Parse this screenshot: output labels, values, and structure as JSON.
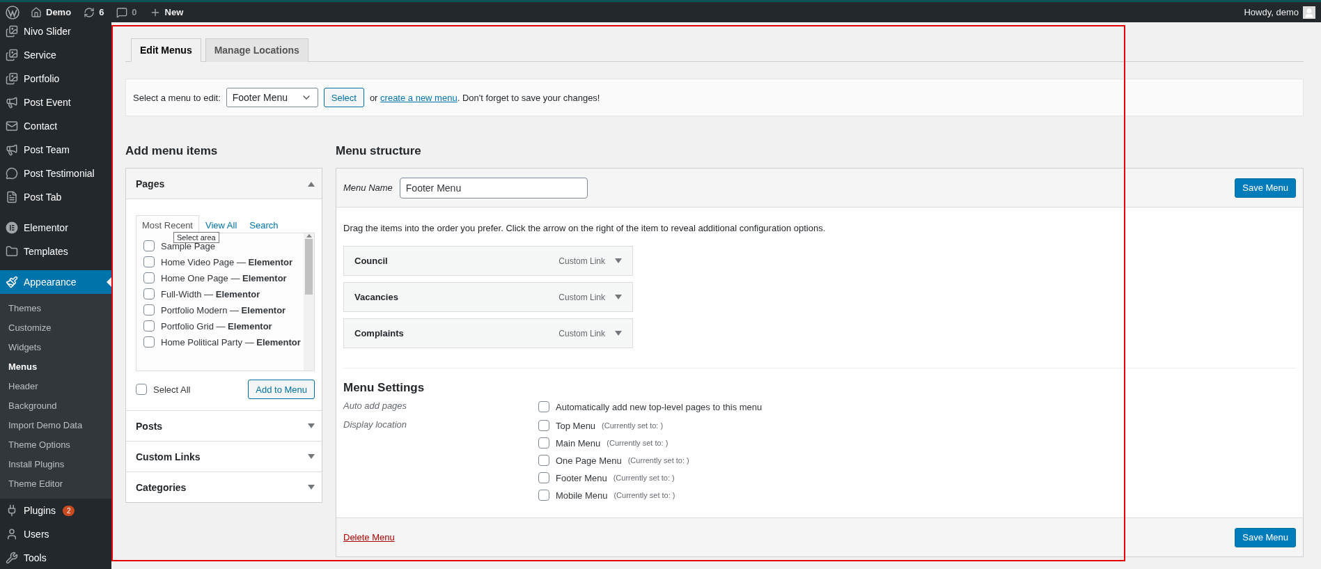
{
  "admin_bar": {
    "items": [
      {
        "label": "Demo"
      },
      {
        "label": "6"
      },
      {
        "label": "0"
      },
      {
        "label": "New"
      }
    ],
    "greeting": "Howdy, demo"
  },
  "sidebar": {
    "sections": [
      {
        "items": [
          {
            "label": "Nivo Slider",
            "selected": false
          },
          {
            "label": "Service",
            "selected": false
          },
          {
            "label": "Portfolio",
            "selected": false
          },
          {
            "label": "Post Event",
            "selected": false
          },
          {
            "label": "Contact",
            "selected": false
          },
          {
            "label": "Post Team",
            "selected": false
          },
          {
            "label": "Post Testimonial",
            "selected": false
          },
          {
            "label": "Post Tab",
            "selected": false
          }
        ]
      },
      {
        "items": [
          {
            "label": "Elementor",
            "selected": false
          },
          {
            "label": "Templates",
            "selected": false
          }
        ]
      },
      {
        "items": [
          {
            "label": "Appearance",
            "selected": true,
            "children": [
              {
                "label": "Themes",
                "selected": false
              },
              {
                "label": "Customize",
                "selected": false
              },
              {
                "label": "Widgets",
                "selected": false
              },
              {
                "label": "Menus",
                "selected": true
              },
              {
                "label": "Header",
                "selected": false
              },
              {
                "label": "Background",
                "selected": false
              },
              {
                "label": "Import Demo Data",
                "selected": false
              },
              {
                "label": "Theme Options",
                "selected": false
              },
              {
                "label": "Install Plugins",
                "selected": false
              },
              {
                "label": "Theme Editor",
                "selected": false
              }
            ]
          },
          {
            "label": "Plugins",
            "selected": false,
            "badge": "2"
          },
          {
            "label": "Users",
            "selected": false
          },
          {
            "label": "Tools",
            "selected": false
          }
        ]
      }
    ]
  },
  "tabs": [
    {
      "label": "Edit Menus",
      "selected": true
    },
    {
      "label": "Manage Locations",
      "selected": false
    }
  ],
  "select_bar": {
    "label": "Select a menu to edit:",
    "value": "Footer Menu",
    "button": "Select",
    "text_before": "or",
    "link": "create a new menu",
    "text_after": ". Don't forget to save your changes!"
  },
  "add_items": {
    "heading": "Add menu items",
    "sections": [
      {
        "title": "Pages",
        "expanded": true,
        "tabs": [
          {
            "label": "Most Recent",
            "selected": true
          },
          {
            "label": "View All",
            "selected": false
          },
          {
            "label": "Search",
            "selected": false
          }
        ],
        "tooltip": "Select area",
        "items": [
          {
            "label": "Sample Page",
            "checked": false
          },
          {
            "label": "Home Video Page — **Elementor**",
            "checked": false
          },
          {
            "label": "Home One Page — **Elementor**",
            "checked": false
          },
          {
            "label": "Full-Width — **Elementor**",
            "checked": false
          },
          {
            "label": "Portfolio Modern — **Elementor**",
            "checked": false
          },
          {
            "label": "Portfolio Grid — **Elementor**",
            "checked": false
          },
          {
            "label": "Home Political Party — **Elementor**",
            "checked": false
          }
        ],
        "select_all": {
          "label": "Select All",
          "checked": false
        },
        "button": "Add to Menu"
      },
      {
        "title": "Posts",
        "expanded": false
      },
      {
        "title": "Custom Links",
        "expanded": false
      },
      {
        "title": "Categories",
        "expanded": false
      }
    ]
  },
  "menu_structure": {
    "heading": "Menu structure",
    "name_label": "Menu Name",
    "name_value": "Footer Menu",
    "save_top": "Save Menu",
    "hint": "Drag the items into the order you prefer. Click the arrow on the right of the item to reveal additional configuration options.",
    "items": [
      {
        "title": "Council",
        "type": "Custom Link",
        "expanded": false
      },
      {
        "title": "Vacancies",
        "type": "Custom Link",
        "expanded": false
      },
      {
        "title": "Complaints",
        "type": "Custom Link",
        "expanded": false
      }
    ],
    "settings": {
      "heading": "Menu Settings",
      "rows": [
        {
          "label": "Auto add pages",
          "options": [
            {
              "label": "Automatically add new top-level pages to this menu",
              "checked": false
            }
          ]
        },
        {
          "label": "Display location",
          "options": [
            {
              "label": "Top Menu",
              "note": "(Currently set to: )",
              "checked": false
            },
            {
              "label": "Main Menu",
              "note": "(Currently set to: )",
              "checked": false
            },
            {
              "label": "One Page Menu",
              "note": "(Currently set to: )",
              "checked": false
            },
            {
              "label": "Footer Menu",
              "note": "(Currently set to: )",
              "checked": false
            },
            {
              "label": "Mobile Menu",
              "note": "(Currently set to: )",
              "checked": false
            }
          ]
        }
      ]
    },
    "delete": "Delete Menu",
    "save_bottom": "Save Menu"
  }
}
